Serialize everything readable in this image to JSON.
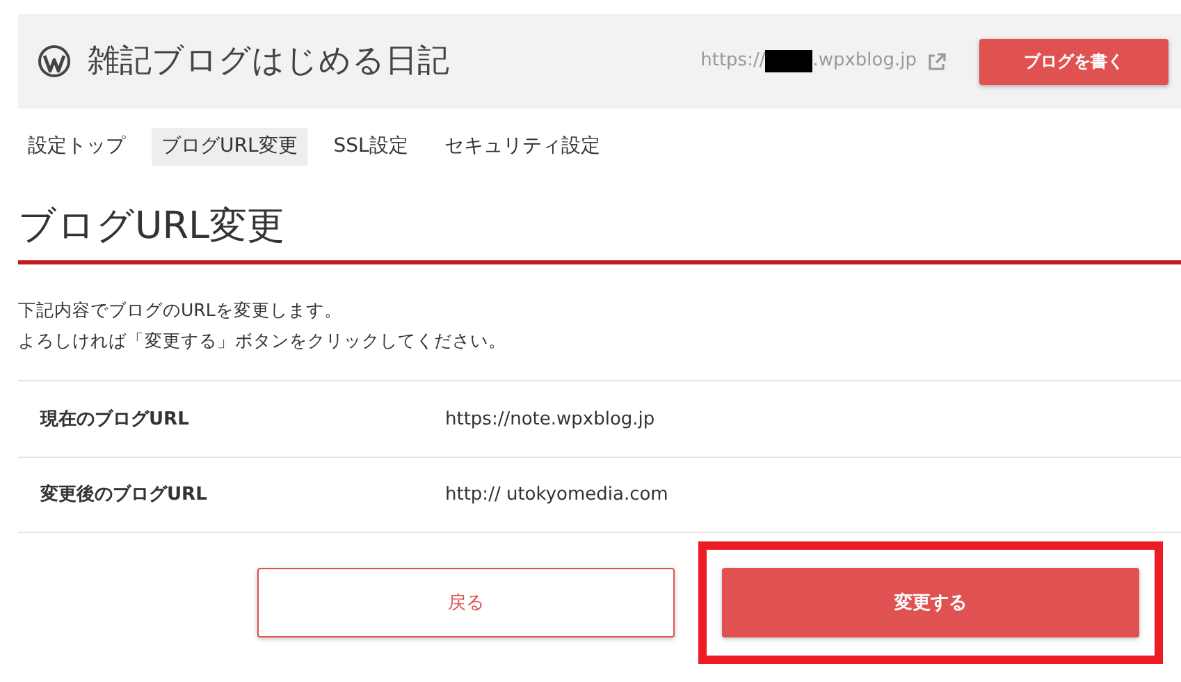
{
  "header": {
    "site_title": "雑記ブログはじめる日記",
    "url_prefix": "https://",
    "url_redacted": true,
    "url_suffix": ".wpxblog.jp",
    "write_button": "ブログを書く"
  },
  "tabs": [
    {
      "label": "設定トップ",
      "selected": false
    },
    {
      "label": "ブログURL変更",
      "selected": true
    },
    {
      "label": "SSL設定",
      "selected": false
    },
    {
      "label": "セキュリティ設定",
      "selected": false
    }
  ],
  "heading": "ブログURL変更",
  "description": [
    "下記内容でブログのURLを変更します。",
    "よろしければ「変更する」ボタンをクリックしてください。"
  ],
  "rows": [
    {
      "label": "現在のブログURL",
      "value": "https://note.wpxblog.jp"
    },
    {
      "label": "変更後のブログURL",
      "value": "http:// utokyomedia.com"
    }
  ],
  "buttons": [
    {
      "label": "戻る",
      "kind": "outline",
      "highlighted": false
    },
    {
      "label": "変更する",
      "kind": "primary",
      "highlighted": true
    }
  ]
}
